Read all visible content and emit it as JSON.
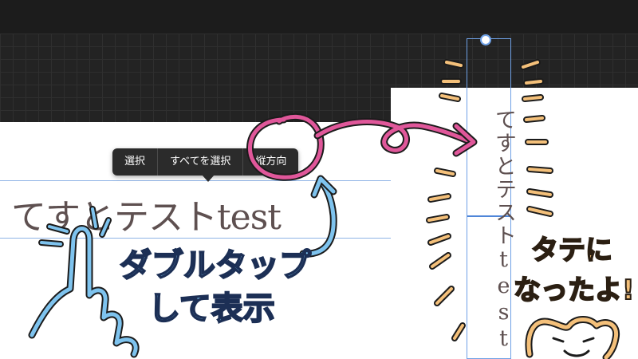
{
  "context_menu": {
    "items": [
      {
        "id": "select",
        "label": "選択"
      },
      {
        "id": "select-all",
        "label": "すべてを選択"
      },
      {
        "id": "vertical",
        "label": "縦方向"
      }
    ]
  },
  "canvas": {
    "horizontal_text": "てすとテストtest",
    "vertical_text": "てすとテストtest"
  },
  "annotations": {
    "left_line1": "ダブルタップ",
    "left_line2": "して表示",
    "right_line1": "タテに",
    "right_line2": "なったよ!"
  },
  "colors": {
    "selection_blue": "#6fa1e6",
    "arrow_pink": "#e0579a",
    "hand_blue": "#7ec3ee",
    "note_orange": "#f4c07a"
  }
}
